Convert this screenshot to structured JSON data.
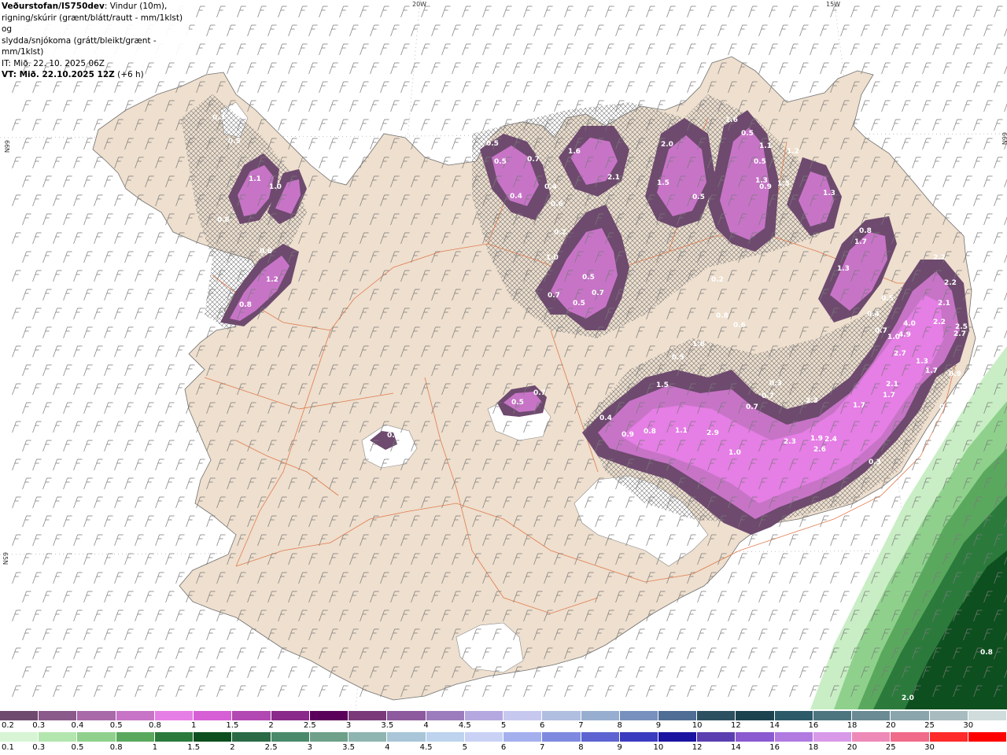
{
  "header": {
    "source": "Veðurstofan/IS750dev",
    "line1_rest": ": Vindur (10m),",
    "line2": "rigning/skúrir (grænt/blátt/rautt - mm/1klst) og",
    "line3": "slydda/snjókoma (grátt/bleikt/grænt - mm/1klst)",
    "it": "IT: Mið. 22. 10. 2025 06Z",
    "vt_bold": "VT: Mið. 22.10.2025 12Z",
    "vt_rest": " (+6 h)"
  },
  "grid_labels": {
    "lon_20w": "20W",
    "lon_15w": "15W",
    "lat_66n_left": "66N",
    "lat_66n_right": "66N",
    "lat_bottom_left": "65N"
  },
  "colors": {
    "land": "#eedfce",
    "land_stroke": "#6f6f6f",
    "roads": "#e07040",
    "snow_light": "#c07adf",
    "snow_mid": "#d24fe6",
    "snow_dark": "#8a3d99",
    "snow_deep": "#5f2f6a",
    "rain_light": "#c9eec5",
    "rain_mid": "#6fbf74",
    "rain_dark": "#1f6b35"
  },
  "precip_labels": [
    "0.3",
    "0.5",
    "1.1",
    "1.0",
    "0.8",
    "0.6",
    "1.2",
    "0.8",
    "0.5",
    "0.7",
    "0.4",
    "0.5",
    "0.4",
    "0.6",
    "0.2",
    "1.0",
    "0.5",
    "0.7",
    "0.5",
    "0.7",
    "1.6",
    "2.0",
    "2.1",
    "1.5",
    "1.6",
    "0.5",
    "0.5",
    "1.1",
    "0.5",
    "1.2",
    "1.3",
    "0.9",
    "1.5",
    "1.3",
    "0.8",
    "1.7",
    "1.3",
    "2.2",
    "2.2",
    "2.1",
    "2.2",
    "2.5",
    "2.7",
    "4.0",
    "4.9",
    "2.7",
    "1.3",
    "1.7",
    "0.9",
    "0.8",
    "0.5",
    "0.4",
    "0.7",
    "1.0",
    "0.3",
    "0.7",
    "1.7",
    "2.1",
    "1.7",
    "2.3",
    "2.6",
    "2.4",
    "2.3",
    "1.0",
    "0.3",
    "1.6",
    "0.5",
    "1.5",
    "0.4",
    "0.9",
    "0.8",
    "1.1",
    "2.9",
    "0.7",
    "0.6",
    "0.8",
    "0.2",
    "0.5",
    "0.5",
    "0.7",
    "1.9",
    "2.0",
    "0.8",
    "0.2"
  ],
  "legend": {
    "snow": {
      "labels": [
        "0.2",
        "0.3",
        "0.4",
        "0.5",
        "0.8",
        "1",
        "1.5",
        "2",
        "2.5",
        "3",
        "3.5",
        "4",
        "4.5",
        "5",
        "6",
        "7",
        "8",
        "9",
        "10",
        "12",
        "14",
        "16",
        "18",
        "20",
        "25",
        "30"
      ],
      "colors": [
        "#6e4a6e",
        "#8a5a8a",
        "#a96aa9",
        "#c774c7",
        "#e57ee5",
        "#d65fd6",
        "#b248b2",
        "#8a2a8a",
        "#5a005a",
        "#7a3a7a",
        "#8d5a9d",
        "#9d7cbd",
        "#b5a8e0",
        "#c6c8f0",
        "#b0bee0",
        "#98aed0",
        "#7890bd",
        "#506d95",
        "#2d5060",
        "#1c4250",
        "#2d5a68",
        "#4d7580",
        "#6a8a94",
        "#8aa5ac",
        "#a8bcbf",
        "#d0dcdc"
      ]
    },
    "rain": {
      "labels": [
        "0.1",
        "0.3",
        "0.5",
        "0.8",
        "1",
        "1.5",
        "2",
        "2.5",
        "3",
        "3.5",
        "4",
        "4.5",
        "5",
        "6",
        "7",
        "8",
        "9",
        "10",
        "12",
        "14",
        "16",
        "18",
        "20",
        "25",
        "30"
      ],
      "colors": [
        "#d7f5d4",
        "#b3e6ae",
        "#8fd18c",
        "#5aa85e",
        "#2b7a3c",
        "#0d4f1e",
        "#2a6a45",
        "#4a8a6a",
        "#6ea08a",
        "#8fb5b0",
        "#a8c6d8",
        "#bdd3ee",
        "#c9d2f5",
        "#a4b0ee",
        "#7e8ae0",
        "#5d63d0",
        "#3b3bbf",
        "#1a14a0",
        "#5b3fb0",
        "#8a5ad0",
        "#b07ae0",
        "#d89ae8",
        "#ee8ab8",
        "#f06a8a",
        "#ff2a2a",
        "#ff0000"
      ]
    }
  }
}
